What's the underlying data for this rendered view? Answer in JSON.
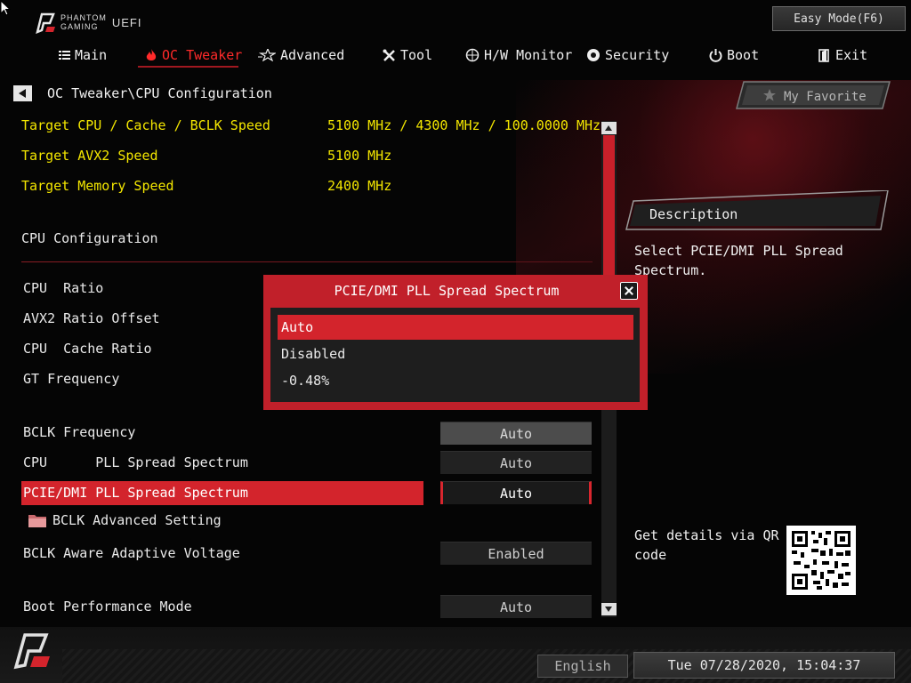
{
  "header": {
    "brand_line1": "PHANTOM",
    "brand_line2": "GAMING",
    "brand_uefi": "UEFI",
    "easy_mode": "Easy Mode(F6)"
  },
  "nav": {
    "main": "Main",
    "oc_tweaker": "OC Tweaker",
    "advanced": "Advanced",
    "tool": "Tool",
    "hw_monitor": "H/W Monitor",
    "security": "Security",
    "boot": "Boot",
    "exit": "Exit",
    "active": "OC Tweaker",
    "active_color": "#ff2a2a"
  },
  "breadcrumb": "OC Tweaker\\CPU Configuration",
  "targets": [
    {
      "label": "Target CPU / Cache / BCLK Speed",
      "value": "5100 MHz / 4300 MHz / 100.0000 MHz"
    },
    {
      "label": "Target AVX2 Speed",
      "value": "5100 MHz"
    },
    {
      "label": "Target Memory Speed",
      "value": "2400 MHz"
    }
  ],
  "section_title": "CPU Configuration",
  "settings": {
    "cpu_ratio": "CPU  Ratio",
    "avx2_offset": "AVX2 Ratio Offset",
    "cache_ratio": "CPU  Cache Ratio",
    "gt_frequency": "GT Frequency",
    "bclk_frequency": {
      "label": "BCLK Frequency",
      "value": "Auto"
    },
    "cpu_pll": {
      "label": "CPU      PLL Spread Spectrum",
      "value": "Auto"
    },
    "pcie_pll": {
      "label": "PCIE/DMI PLL Spread Spectrum",
      "value": "Auto"
    },
    "bclk_advanced": "BCLK Advanced Setting",
    "bclk_aware": {
      "label": "BCLK Aware Adaptive Voltage",
      "value": "Enabled"
    },
    "boot_perf": {
      "label": "Boot Performance Mode",
      "value": "Auto"
    }
  },
  "right_panel": {
    "favorite": "My Favorite",
    "description_title": "Description",
    "description_text": "Select PCIE/DMI PLL Spread Spectrum.",
    "qr_text": "Get details via QR code"
  },
  "popup": {
    "title": "PCIE/DMI PLL Spread Spectrum",
    "options": [
      "Auto",
      "Disabled",
      "-0.48%"
    ],
    "selected": "Auto"
  },
  "footer": {
    "language": "English",
    "datetime": "Tue 07/28/2020, 15:04:37"
  },
  "colors": {
    "accent_red": "#d3242c",
    "target_yellow": "#f3e600"
  }
}
